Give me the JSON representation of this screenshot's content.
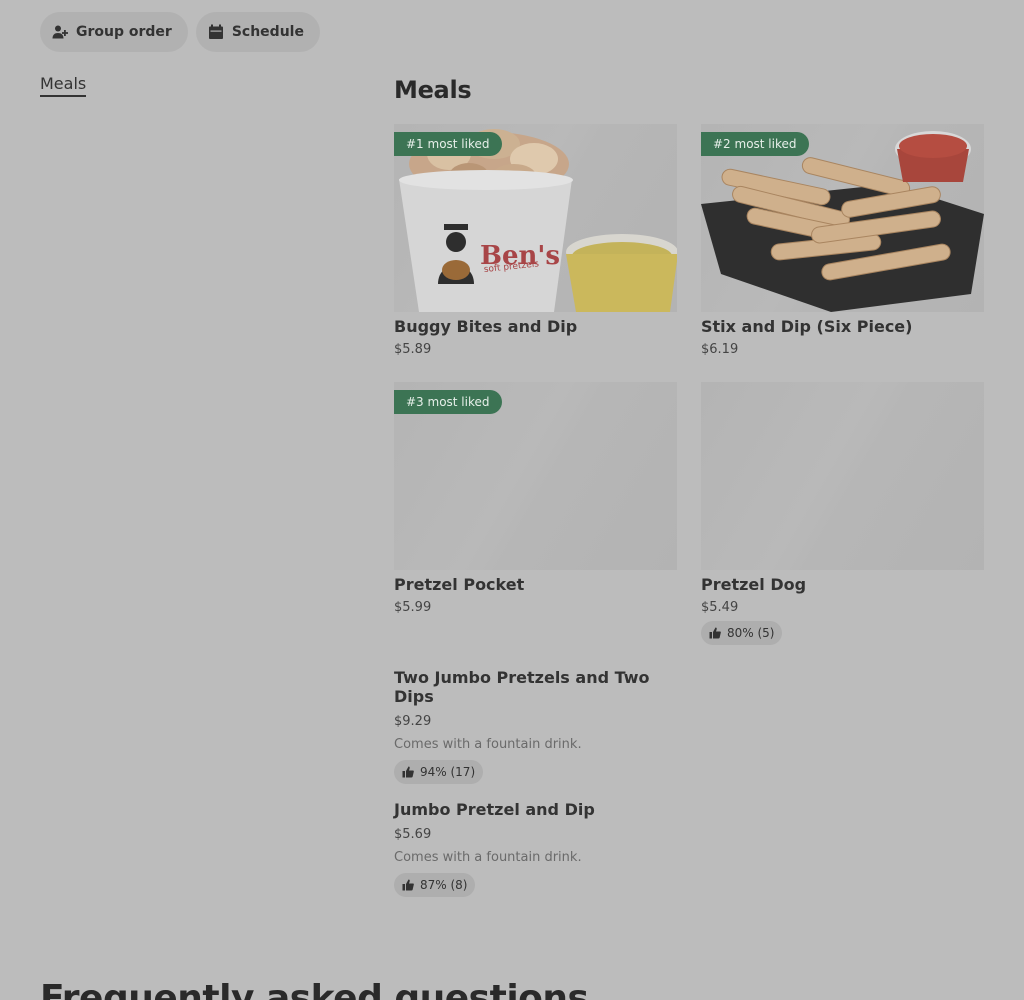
{
  "top_actions": {
    "group_order_label": "Group order",
    "schedule_label": "Schedule"
  },
  "nav": {
    "categories": [
      "Meals"
    ]
  },
  "section": {
    "title": "Meals"
  },
  "cards": [
    {
      "badge": "#1 most liked",
      "name": "Buggy Bites and Dip",
      "price": "$5.89",
      "brand_text": "Ben's",
      "brand_sub": "soft pretzels"
    },
    {
      "badge": "#2 most liked",
      "name": "Stix and Dip (Six Piece)",
      "price": "$6.19"
    },
    {
      "badge": "#3 most liked",
      "name": "Pretzel Pocket",
      "price": "$5.99"
    },
    {
      "name": "Pretzel Dog",
      "price": "$5.49",
      "rating": "80% (5)"
    }
  ],
  "list_items": [
    {
      "name": "Two Jumbo Pretzels and Two Dips",
      "price": "$9.29",
      "description": "Comes with a fountain drink.",
      "rating": "94% (17)"
    },
    {
      "name": "Jumbo Pretzel and Dip",
      "price": "$5.69",
      "description": "Comes with a fountain drink.",
      "rating": "87% (8)"
    }
  ],
  "faq": {
    "title": "Frequently asked questions"
  },
  "colors": {
    "badge_green": "#3c7454",
    "overlay_gray": "#bcbcbc"
  }
}
